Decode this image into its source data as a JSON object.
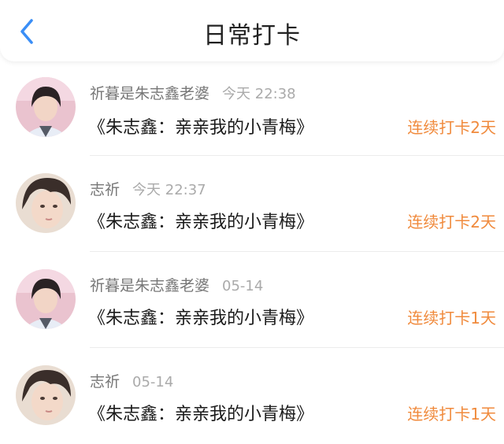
{
  "header": {
    "title": "日常打卡",
    "back_icon": "chevron-left-icon",
    "accent_color": "#3a8ef6"
  },
  "items": [
    {
      "name": "祈暮是朱志鑫老婆",
      "time": "今天 22:38",
      "content": "《朱志鑫：亲亲我的小青梅》",
      "streak": "连续打卡2天"
    },
    {
      "name": "志祈",
      "time": "今天 22:37",
      "content": "《朱志鑫：亲亲我的小青梅》",
      "streak": "连续打卡2天"
    },
    {
      "name": "祈暮是朱志鑫老婆",
      "time": "05-14",
      "content": "《朱志鑫：亲亲我的小青梅》",
      "streak": "连续打卡1天"
    },
    {
      "name": "志祈",
      "time": "05-14",
      "content": "《朱志鑫：亲亲我的小青梅》",
      "streak": "连续打卡1天"
    }
  ],
  "colors": {
    "streak": "#f08a3c",
    "name": "#777777",
    "time": "#aaaaaa"
  }
}
